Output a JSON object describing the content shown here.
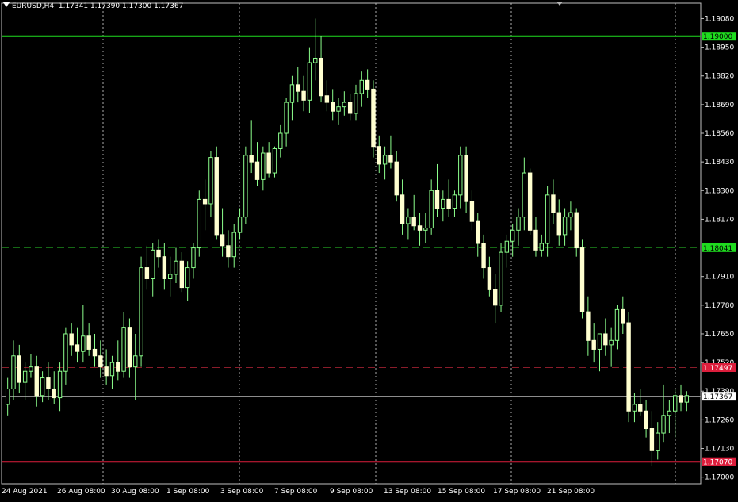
{
  "header": {
    "symbol": "EURUSD,H4",
    "ohlc": "1.17341 1.17390 1.17300 1.17367"
  },
  "colors": {
    "background": "#000000",
    "frame": "#c0c0c0",
    "candle_up_body": "#000000",
    "candle_down_body": "#ffffd0",
    "candle_wick": "#8cff8c",
    "grid": "#c8c8c8",
    "resistance_line": "#1fdc1f",
    "midline": "#1c8a1c",
    "dashed_red": "#8a1c2a",
    "support_line": "#dc1e3c",
    "current_price_line": "#a0a0a0"
  },
  "chart_data": {
    "type": "candlestick",
    "symbol": "EURUSD",
    "timeframe": "H4",
    "price_axis_ticks": [
      "1.19080",
      "1.18950",
      "1.18820",
      "1.18690",
      "1.18560",
      "1.18430",
      "1.18300",
      "1.18170",
      "1.17910",
      "1.17780",
      "1.17650",
      "1.17520",
      "1.17390",
      "1.17260",
      "1.17130",
      "1.17000"
    ],
    "time_axis_labels": [
      "24 Aug 2021",
      "26 Aug 08:00",
      "30 Aug 08:00",
      "1 Sep 08:00",
      "3 Sep 08:00",
      "7 Sep 08:00",
      "9 Sep 08:00",
      "13 Sep 08:00",
      "15 Sep 08:00",
      "17 Sep 08:00",
      "21 Sep 08:00"
    ],
    "ylim": [
      1.1697,
      1.1915
    ],
    "grid": "vertical dotted",
    "levels": [
      {
        "price": 1.19,
        "label": "1.19000",
        "style": "solid",
        "color": "#1fdc1f",
        "tag_bg": "#1fdc1f",
        "tag_fg": "#000000"
      },
      {
        "price": 1.18041,
        "label": "1.18041",
        "style": "dashed",
        "color": "#1c8a1c",
        "tag_bg": "#1fdc1f",
        "tag_fg": "#000000"
      },
      {
        "price": 1.17497,
        "label": "1.17497",
        "style": "dashed",
        "color": "#8a1c2a",
        "tag_bg": "#dc1e3c",
        "tag_fg": "#ffffff"
      },
      {
        "price": 1.17367,
        "label": "1.17367",
        "style": "solid-thin",
        "color": "#a0a0a0",
        "tag_bg": "#ffffff",
        "tag_fg": "#000000"
      },
      {
        "price": 1.1707,
        "label": "1.17070",
        "style": "solid",
        "color": "#dc1e3c",
        "tag_bg": "#dc1e3c",
        "tag_fg": "#ffffff"
      }
    ],
    "candles": [
      [
        1.1733,
        1.1745,
        1.1728,
        1.174
      ],
      [
        1.174,
        1.1762,
        1.1735,
        1.1755
      ],
      [
        1.1755,
        1.176,
        1.1738,
        1.1743
      ],
      [
        1.1743,
        1.1752,
        1.1735,
        1.1748
      ],
      [
        1.1748,
        1.1756,
        1.1745,
        1.175
      ],
      [
        1.175,
        1.1755,
        1.1732,
        1.1737
      ],
      [
        1.1737,
        1.1748,
        1.1734,
        1.1745
      ],
      [
        1.1745,
        1.1752,
        1.1735,
        1.174
      ],
      [
        1.174,
        1.1748,
        1.1733,
        1.1736
      ],
      [
        1.1736,
        1.1752,
        1.173,
        1.1748
      ],
      [
        1.1748,
        1.1768,
        1.1742,
        1.1765
      ],
      [
        1.1765,
        1.177,
        1.1755,
        1.176
      ],
      [
        1.176,
        1.1768,
        1.1752,
        1.1757
      ],
      [
        1.1757,
        1.1778,
        1.1752,
        1.1764
      ],
      [
        1.1764,
        1.177,
        1.1755,
        1.1758
      ],
      [
        1.1758,
        1.1765,
        1.175,
        1.1755
      ],
      [
        1.1755,
        1.1762,
        1.1745,
        1.175
      ],
      [
        1.175,
        1.1758,
        1.1742,
        1.1746
      ],
      [
        1.1746,
        1.1755,
        1.174,
        1.1752
      ],
      [
        1.1752,
        1.1762,
        1.1744,
        1.1748
      ],
      [
        1.1748,
        1.1775,
        1.1745,
        1.1768
      ],
      [
        1.1768,
        1.1772,
        1.1745,
        1.175
      ],
      [
        1.175,
        1.1765,
        1.1735,
        1.1755
      ],
      [
        1.1755,
        1.18,
        1.175,
        1.1795
      ],
      [
        1.1795,
        1.1805,
        1.1785,
        1.179
      ],
      [
        1.179,
        1.1806,
        1.1782,
        1.1803
      ],
      [
        1.1803,
        1.1808,
        1.1795,
        1.18
      ],
      [
        1.18,
        1.1806,
        1.1785,
        1.179
      ],
      [
        1.179,
        1.18,
        1.1782,
        1.1792
      ],
      [
        1.1792,
        1.1804,
        1.1788,
        1.1798
      ],
      [
        1.1798,
        1.1802,
        1.1784,
        1.1786
      ],
      [
        1.1786,
        1.1798,
        1.178,
        1.1795
      ],
      [
        1.1795,
        1.1806,
        1.179,
        1.1804
      ],
      [
        1.1804,
        1.183,
        1.18,
        1.1826
      ],
      [
        1.1826,
        1.1835,
        1.1812,
        1.1824
      ],
      [
        1.1824,
        1.1848,
        1.1818,
        1.1845
      ],
      [
        1.1845,
        1.185,
        1.1808,
        1.181
      ],
      [
        1.181,
        1.1822,
        1.18,
        1.1805
      ],
      [
        1.1805,
        1.1812,
        1.1795,
        1.18
      ],
      [
        1.18,
        1.1815,
        1.1795,
        1.1811
      ],
      [
        1.1811,
        1.1822,
        1.1808,
        1.1818
      ],
      [
        1.1818,
        1.185,
        1.1815,
        1.1846
      ],
      [
        1.1846,
        1.1862,
        1.1838,
        1.1843
      ],
      [
        1.1843,
        1.1852,
        1.1832,
        1.1835
      ],
      [
        1.1835,
        1.185,
        1.183,
        1.1847
      ],
      [
        1.1847,
        1.1852,
        1.1836,
        1.1838
      ],
      [
        1.1838,
        1.185,
        1.1836,
        1.1849
      ],
      [
        1.1849,
        1.186,
        1.1845,
        1.1856
      ],
      [
        1.1856,
        1.1872,
        1.185,
        1.187
      ],
      [
        1.187,
        1.1882,
        1.1862,
        1.1878
      ],
      [
        1.1878,
        1.1886,
        1.187,
        1.1875
      ],
      [
        1.1875,
        1.1882,
        1.1866,
        1.1871
      ],
      [
        1.1871,
        1.1895,
        1.1865,
        1.1888
      ],
      [
        1.1888,
        1.1908,
        1.188,
        1.189
      ],
      [
        1.189,
        1.19,
        1.187,
        1.1873
      ],
      [
        1.1873,
        1.188,
        1.1866,
        1.187
      ],
      [
        1.187,
        1.1876,
        1.1862,
        1.1866
      ],
      [
        1.1866,
        1.1872,
        1.186,
        1.1868
      ],
      [
        1.1868,
        1.1875,
        1.1864,
        1.187
      ],
      [
        1.187,
        1.1874,
        1.1862,
        1.1865
      ],
      [
        1.1865,
        1.1878,
        1.1862,
        1.1874
      ],
      [
        1.1874,
        1.1884,
        1.1868,
        1.188
      ],
      [
        1.188,
        1.1885,
        1.1872,
        1.1876
      ],
      [
        1.1876,
        1.188,
        1.1845,
        1.185
      ],
      [
        1.185,
        1.1855,
        1.1838,
        1.1842
      ],
      [
        1.1842,
        1.185,
        1.1835,
        1.1846
      ],
      [
        1.1846,
        1.1855,
        1.184,
        1.1843
      ],
      [
        1.1843,
        1.1848,
        1.1825,
        1.1828
      ],
      [
        1.1828,
        1.1835,
        1.181,
        1.1815
      ],
      [
        1.1815,
        1.1822,
        1.1808,
        1.1818
      ],
      [
        1.1818,
        1.1828,
        1.1812,
        1.1814
      ],
      [
        1.1814,
        1.182,
        1.1805,
        1.1812
      ],
      [
        1.1812,
        1.182,
        1.1806,
        1.1813
      ],
      [
        1.1813,
        1.1835,
        1.181,
        1.183
      ],
      [
        1.183,
        1.1842,
        1.1818,
        1.1822
      ],
      [
        1.1822,
        1.183,
        1.1816,
        1.1826
      ],
      [
        1.1826,
        1.1835,
        1.1818,
        1.1822
      ],
      [
        1.1822,
        1.183,
        1.1818,
        1.1828
      ],
      [
        1.1828,
        1.185,
        1.1822,
        1.1846
      ],
      [
        1.1846,
        1.185,
        1.182,
        1.1825
      ],
      [
        1.1825,
        1.183,
        1.1812,
        1.1816
      ],
      [
        1.1816,
        1.182,
        1.18,
        1.1806
      ],
      [
        1.1806,
        1.181,
        1.179,
        1.1795
      ],
      [
        1.1795,
        1.18,
        1.1782,
        1.1785
      ],
      [
        1.1785,
        1.1792,
        1.177,
        1.1778
      ],
      [
        1.1778,
        1.1806,
        1.1775,
        1.1802
      ],
      [
        1.1802,
        1.181,
        1.1795,
        1.1807
      ],
      [
        1.1807,
        1.1815,
        1.18,
        1.1812
      ],
      [
        1.1812,
        1.1822,
        1.1805,
        1.1818
      ],
      [
        1.1818,
        1.1845,
        1.1812,
        1.1838
      ],
      [
        1.1838,
        1.184,
        1.181,
        1.1812
      ],
      [
        1.1812,
        1.1818,
        1.18,
        1.1803
      ],
      [
        1.1803,
        1.181,
        1.18,
        1.1806
      ],
      [
        1.1806,
        1.1832,
        1.18,
        1.1828
      ],
      [
        1.1828,
        1.1835,
        1.1815,
        1.182
      ],
      [
        1.182,
        1.1826,
        1.1805,
        1.181
      ],
      [
        1.181,
        1.1822,
        1.1805,
        1.1818
      ],
      [
        1.1818,
        1.1825,
        1.1812,
        1.182
      ],
      [
        1.182,
        1.1822,
        1.18,
        1.1804
      ],
      [
        1.1804,
        1.1808,
        1.1772,
        1.1775
      ],
      [
        1.1775,
        1.1782,
        1.1755,
        1.1762
      ],
      [
        1.1762,
        1.177,
        1.1752,
        1.1758
      ],
      [
        1.1758,
        1.1765,
        1.1748,
        1.1765
      ],
      [
        1.1765,
        1.1772,
        1.1755,
        1.176
      ],
      [
        1.176,
        1.1768,
        1.175,
        1.1762
      ],
      [
        1.1762,
        1.1778,
        1.1758,
        1.1776
      ],
      [
        1.1776,
        1.1782,
        1.1765,
        1.177
      ],
      [
        1.177,
        1.1775,
        1.1725,
        1.173
      ],
      [
        1.173,
        1.1738,
        1.1725,
        1.1733
      ],
      [
        1.1733,
        1.174,
        1.1728,
        1.173
      ],
      [
        1.173,
        1.1735,
        1.1718,
        1.1722
      ],
      [
        1.1722,
        1.173,
        1.1705,
        1.1712
      ],
      [
        1.1712,
        1.1725,
        1.1708,
        1.172
      ],
      [
        1.172,
        1.1742,
        1.1716,
        1.1728
      ],
      [
        1.1728,
        1.1735,
        1.172,
        1.173
      ],
      [
        1.173,
        1.174,
        1.1718,
        1.1737
      ],
      [
        1.1737,
        1.1742,
        1.173,
        1.1734
      ],
      [
        1.1734,
        1.1739,
        1.173,
        1.1737
      ]
    ]
  }
}
